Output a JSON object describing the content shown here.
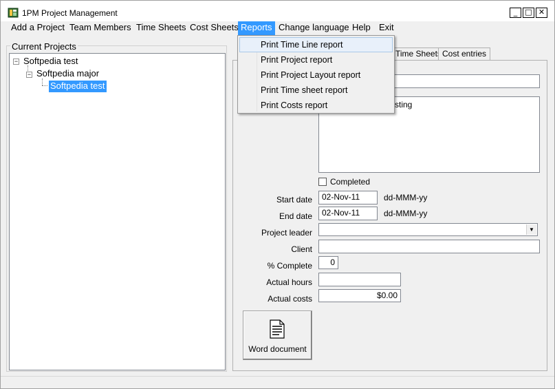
{
  "window": {
    "title": "1PM Project Management",
    "minimize_glyph": "_",
    "maximize_glyph": "□",
    "close_glyph": "✕"
  },
  "menu": {
    "items": [
      {
        "label": "Add a Project"
      },
      {
        "label": "Team Members"
      },
      {
        "label": "Time Sheets"
      },
      {
        "label": "Cost Sheets"
      },
      {
        "label": "Reports"
      },
      {
        "label": "Change language"
      },
      {
        "label": "Help"
      },
      {
        "label": "Exit"
      }
    ],
    "active": "Reports"
  },
  "reports_menu": {
    "items": [
      {
        "label": "Print Time Line report"
      },
      {
        "label": "Print Project report"
      },
      {
        "label": "Print Project Layout report"
      },
      {
        "label": "Print Time sheet report"
      },
      {
        "label": "Print Costs report"
      }
    ]
  },
  "projects_panel": {
    "title": "Current Projects",
    "tree": {
      "root": "Softpedia test",
      "child": "Softpedia major",
      "grandchild": "Softpedia test"
    }
  },
  "tabs": {
    "items": [
      {
        "label": "Time Sheets"
      },
      {
        "label": "Cost entries"
      }
    ]
  },
  "form": {
    "description_visible_text": "sting",
    "completed_label": "Completed",
    "start_date_label": "Start date",
    "start_date_value": "02-Nov-11",
    "end_date_label": "End date",
    "end_date_value": "02-Nov-11",
    "date_format_hint": "dd-MMM-yy",
    "project_leader_label": "Project leader",
    "client_label": "Client",
    "percent_complete_label": "% Complete",
    "percent_complete_value": "0",
    "actual_hours_label": "Actual hours",
    "actual_costs_label": "Actual costs",
    "actual_costs_value": "$0.00"
  },
  "word_button": {
    "label": "Word document",
    "icon": "document-icon"
  },
  "colors": {
    "selection": "#3399ff",
    "menu_hover": "#e8f0fa"
  }
}
